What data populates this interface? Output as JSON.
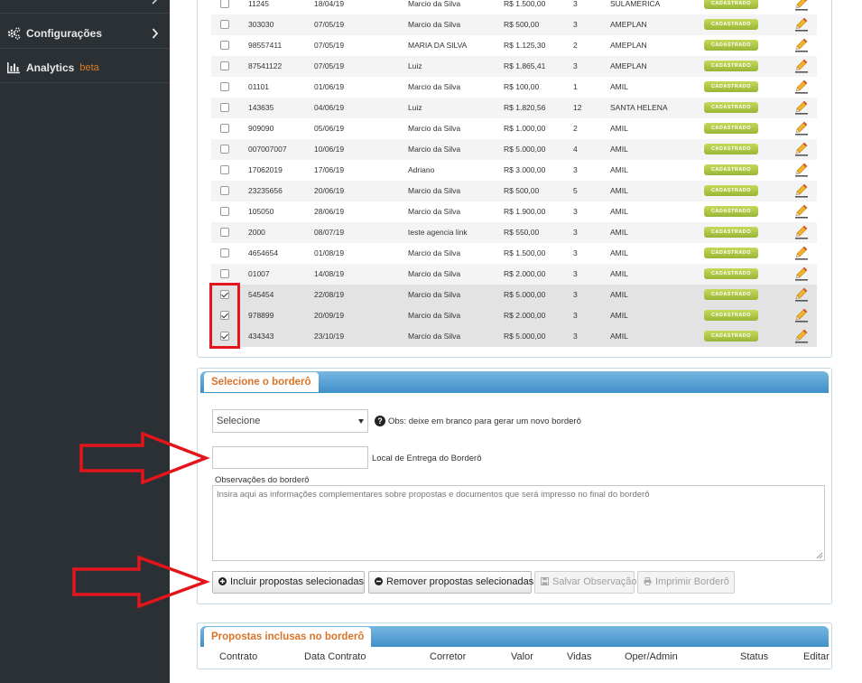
{
  "sidebar": {
    "items": [
      {
        "label": "Configurações",
        "icon": "gears-icon"
      },
      {
        "label": "Analytics",
        "badge": "beta",
        "icon": "bar-chart-icon"
      }
    ]
  },
  "contracts_table": {
    "status_label": "CADASTRADO",
    "rows": [
      {
        "checked": false,
        "contrato": "11245",
        "data": "18/04/19",
        "corretor": "Marcio da Silva",
        "valor": "R$ 1.500,00",
        "vidas": "3",
        "operadora": "SULAMERICA"
      },
      {
        "checked": false,
        "contrato": "303030",
        "data": "07/05/19",
        "corretor": "Marcio da Silva",
        "valor": "R$ 500,00",
        "vidas": "3",
        "operadora": "AMEPLAN"
      },
      {
        "checked": false,
        "contrato": "98557411",
        "data": "07/05/19",
        "corretor": "MARIA DA SILVA",
        "valor": "R$ 1.125,30",
        "vidas": "2",
        "operadora": "AMEPLAN"
      },
      {
        "checked": false,
        "contrato": "87541122",
        "data": "07/05/19",
        "corretor": "Luiz",
        "valor": "R$ 1.865,41",
        "vidas": "3",
        "operadora": "AMEPLAN"
      },
      {
        "checked": false,
        "contrato": "01101",
        "data": "01/06/19",
        "corretor": "Marcio da Silva",
        "valor": "R$ 100,00",
        "vidas": "1",
        "operadora": "AMIL"
      },
      {
        "checked": false,
        "contrato": "143635",
        "data": "04/06/19",
        "corretor": "Luiz",
        "valor": "R$ 1.820,56",
        "vidas": "12",
        "operadora": "SANTA HELENA"
      },
      {
        "checked": false,
        "contrato": "909090",
        "data": "05/06/19",
        "corretor": "Marcio da Silva",
        "valor": "R$ 1.000,00",
        "vidas": "2",
        "operadora": "AMIL"
      },
      {
        "checked": false,
        "contrato": "007007007",
        "data": "10/06/19",
        "corretor": "Marcio da Silva",
        "valor": "R$ 5.000,00",
        "vidas": "4",
        "operadora": "AMIL"
      },
      {
        "checked": false,
        "contrato": "17062019",
        "data": "17/06/19",
        "corretor": "Adriano",
        "valor": "R$ 3.000,00",
        "vidas": "3",
        "operadora": "AMIL"
      },
      {
        "checked": false,
        "contrato": "23235656",
        "data": "20/06/19",
        "corretor": "Marcio da Silva",
        "valor": "R$ 500,00",
        "vidas": "5",
        "operadora": "AMIL"
      },
      {
        "checked": false,
        "contrato": "105050",
        "data": "28/06/19",
        "corretor": "Marcio da Silva",
        "valor": "R$ 1.900,00",
        "vidas": "3",
        "operadora": "AMIL"
      },
      {
        "checked": false,
        "contrato": "2000",
        "data": "08/07/19",
        "corretor": "teste agencia link",
        "valor": "R$ 550,00",
        "vidas": "3",
        "operadora": "AMIL"
      },
      {
        "checked": false,
        "contrato": "4654654",
        "data": "01/08/19",
        "corretor": "Marcio da Silva",
        "valor": "R$ 1.500,00",
        "vidas": "3",
        "operadora": "AMIL"
      },
      {
        "checked": false,
        "contrato": "01007",
        "data": "14/08/19",
        "corretor": "Marcio da Silva",
        "valor": "R$ 2.000,00",
        "vidas": "3",
        "operadora": "AMIL"
      },
      {
        "checked": true,
        "contrato": "545454",
        "data": "22/08/19",
        "corretor": "Marcio da Silva",
        "valor": "R$ 5.000,00",
        "vidas": "3",
        "operadora": "AMIL"
      },
      {
        "checked": true,
        "contrato": "978899",
        "data": "20/09/19",
        "corretor": "Marcio da Silva",
        "valor": "R$ 2.000,00",
        "vidas": "3",
        "operadora": "AMIL"
      },
      {
        "checked": true,
        "contrato": "434343",
        "data": "23/10/19",
        "corretor": "Marcio da Silva",
        "valor": "R$ 5.000,00",
        "vidas": "3",
        "operadora": "AMIL"
      }
    ]
  },
  "bordero": {
    "tab_label": "Selecione o borderô",
    "select_value": "Selecione",
    "select_note": "Obs: deixe em branco para gerar um novo borderô",
    "local_value": "",
    "local_label": "Local de Entrega do Borderô",
    "obs_label": "Observações do borderô",
    "obs_placeholder": "Insira aqui as informações complementares sobre propostas e documentos que será impresso no final do borderô",
    "buttons": {
      "incluir": "Incluir propostas selecionadas",
      "remover": "Remover propostas selecionadas",
      "salvar": "Salvar Observação",
      "imprimir": "Imprimir Borderô"
    }
  },
  "inclusas": {
    "tab_label": "Propostas inclusas no borderô",
    "headers": [
      "Contrato",
      "Data Contrato",
      "Corretor",
      "Valor",
      "Vidas",
      "Oper/Admin",
      "Status",
      "Editar"
    ]
  },
  "colors": {
    "sidebar_bg": "#2a3034",
    "accent_orange": "#d9742a",
    "tab_blue": "#3f8fc9",
    "status_green": "#a9c23f",
    "annotation_red": "#e3141b"
  }
}
